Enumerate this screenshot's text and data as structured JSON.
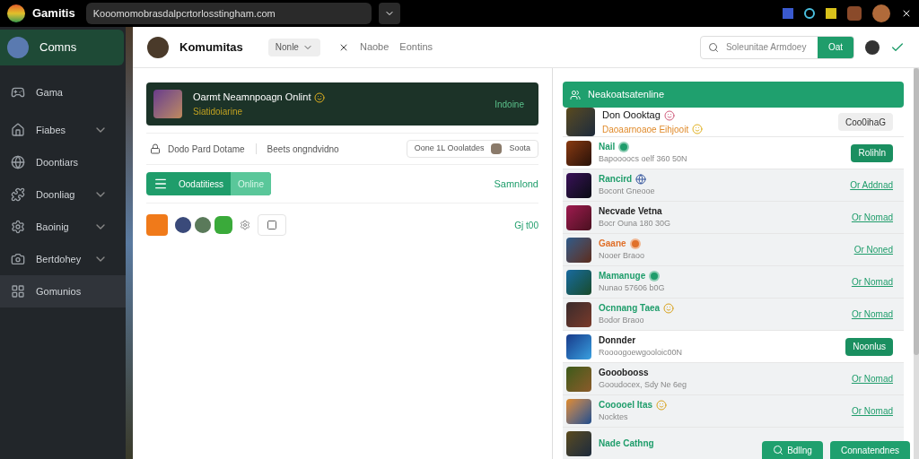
{
  "topbar": {
    "app_name": "Gamitis",
    "address": "Kooomomobrasdalpcrtorlosstingham.com"
  },
  "sidebar": {
    "items": [
      {
        "label": "Comns",
        "kind": "profile",
        "selected": true,
        "expandable": false,
        "hovered": false
      },
      {
        "label": "Gama",
        "kind": "plain",
        "selected": false,
        "expandable": false,
        "hovered": false
      },
      {
        "label": "Fiabes",
        "kind": "plain",
        "selected": false,
        "expandable": true,
        "hovered": false
      },
      {
        "label": "Doontiars",
        "kind": "plain",
        "selected": false,
        "expandable": false,
        "hovered": false
      },
      {
        "label": "Doonliag",
        "kind": "plain",
        "selected": false,
        "expandable": true,
        "hovered": false
      },
      {
        "label": "Baoinig",
        "kind": "plain",
        "selected": false,
        "expandable": true,
        "hovered": false
      },
      {
        "label": "Bertdohey",
        "kind": "plain",
        "selected": false,
        "expandable": true,
        "hovered": false
      },
      {
        "label": "Gomunios",
        "kind": "plain",
        "selected": false,
        "expandable": false,
        "hovered": true
      }
    ]
  },
  "header": {
    "title": "Komumitas",
    "dropdown": "Nonle",
    "nav": [
      "Naobe",
      "Eontins"
    ],
    "search": {
      "placeholder": "Soleunitae Armdoey",
      "button": "Oat"
    }
  },
  "banner": {
    "title": "Oarmt Neamnpoagn Onlint",
    "subtitle": "Siatidoiarine",
    "side": "Indoine"
  },
  "info_row": {
    "left": "Dodo Pard Dotame",
    "middle": "Beets ongndvidno",
    "chip": "Oone 1L Ooolatdes",
    "chip_action": "Soota"
  },
  "tabs": [
    {
      "label": "Oodatitiess",
      "selected": true
    },
    {
      "label": "Online",
      "selected": false
    }
  ],
  "tabs_side": "Samnlond",
  "icons_side": "Gj t00",
  "friends": {
    "title": "Neakoatsatenline",
    "featured": {
      "name": "Don Oooktag",
      "sub": "Daoaarnoaoe Eihjooit",
      "button": "Coo0ihaG"
    },
    "rows": [
      {
        "name": "Nail",
        "color": "#1f9d6b",
        "sub": "Bapoooocs oelf 360 50N",
        "dot": true,
        "globe": false,
        "emoji": false,
        "kind": "button",
        "action": "Rolihln"
      },
      {
        "name": "Rancird",
        "color": "#1f9d6b",
        "sub": "Bocont Gneooe",
        "dot": false,
        "globe": true,
        "emoji": false,
        "kind": "link",
        "action": "Or Addnad"
      },
      {
        "name": "Necvade Vetna",
        "color": "#222222",
        "sub": "Bocr Ouna 180 30G",
        "dot": false,
        "globe": false,
        "emoji": false,
        "kind": "link",
        "action": "Or Nomad"
      },
      {
        "name": "Gaane",
        "color": "#e0702a",
        "sub": "Nooer Braoo",
        "dot": true,
        "globe": false,
        "emoji": false,
        "kind": "link",
        "action": "Or Noned"
      },
      {
        "name": "Mamanuge",
        "color": "#1f9d6b",
        "sub": "Nunao 57606 b0G",
        "dot": true,
        "globe": false,
        "emoji": false,
        "kind": "link",
        "action": "Or Nomad"
      },
      {
        "name": "Ocnnang Taea",
        "color": "#1f9d6b",
        "sub": "Bodor Braoo",
        "dot": false,
        "globe": false,
        "emoji": true,
        "kind": "link",
        "action": "Or Nomad"
      },
      {
        "name": "Donnder",
        "color": "#222222",
        "sub": "Roooogoewgooloic00N",
        "dot": false,
        "globe": false,
        "emoji": false,
        "kind": "button",
        "action": "Noonlus"
      },
      {
        "name": "Gooobooss",
        "color": "#222222",
        "sub": "Gooudocex, Sdy Ne 6eg",
        "dot": false,
        "globe": false,
        "emoji": false,
        "kind": "link",
        "action": "Or Nomad"
      },
      {
        "name": "Cooooel Itas",
        "color": "#1f9d6b",
        "sub": "Nocktes",
        "dot": false,
        "globe": false,
        "emoji": true,
        "kind": "link",
        "action": "Or Nomad"
      },
      {
        "name": "Nade Cathng",
        "color": "#1f9d6b",
        "dot": false,
        "globe": false,
        "emoji": false,
        "kind": "none"
      }
    ]
  },
  "floating": [
    "Bdllng",
    "Connatendnes"
  ]
}
